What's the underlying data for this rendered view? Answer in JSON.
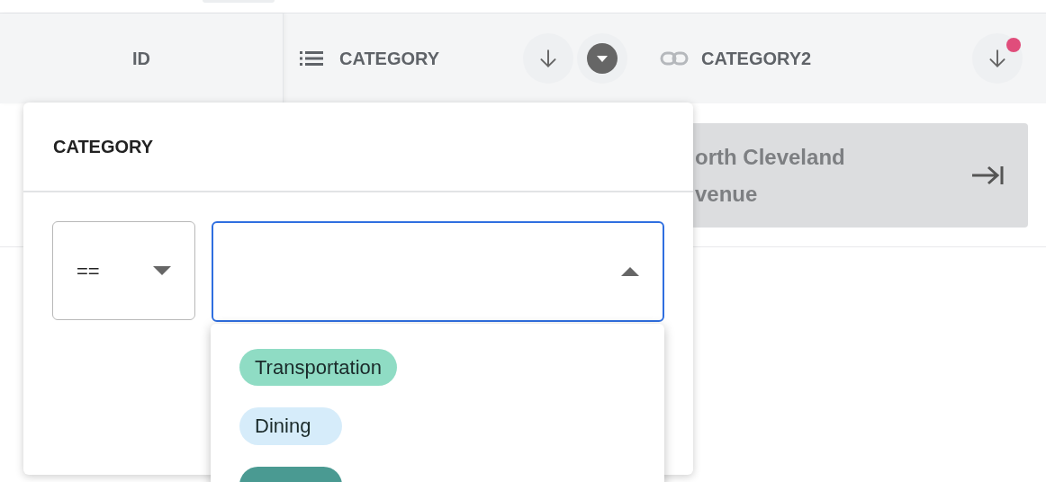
{
  "header": {
    "columns": [
      {
        "kind": "id",
        "label": "ID"
      },
      {
        "kind": "list",
        "label": "CATEGORY",
        "filter_active": true
      },
      {
        "kind": "link",
        "label": "CATEGORY2",
        "notification": true
      }
    ]
  },
  "row": {
    "cell_text": "orth Cleveland venue"
  },
  "filter_popover": {
    "title": "CATEGORY",
    "operator": "==",
    "dropdown_open": true,
    "options": [
      {
        "label": "Transportation",
        "color": "#8fdcc4"
      },
      {
        "label": "Dining",
        "color": "#d6ecfa"
      },
      {
        "color": "#4a9a92"
      }
    ]
  }
}
